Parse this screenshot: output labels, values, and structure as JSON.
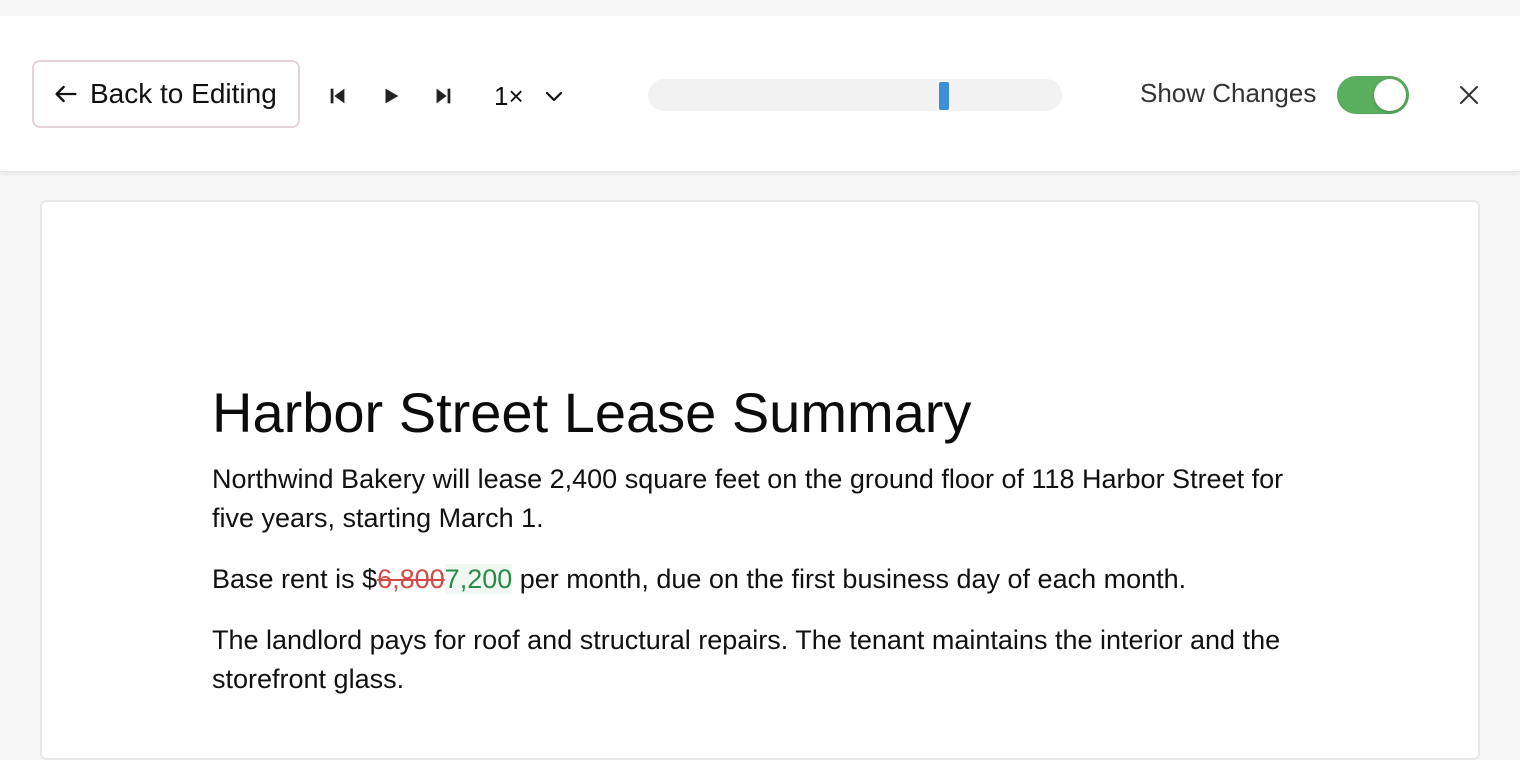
{
  "toolbar": {
    "back_label": "Back to Editing",
    "speed_label": "1×",
    "show_changes_label": "Show Changes",
    "show_changes_on": true,
    "timeline_position": 0.715,
    "colors": {
      "toggle_on": "#5aaf5f",
      "timeline_thumb": "#3f8fd6"
    },
    "icons": [
      "arrow-left-icon",
      "skip-back-icon",
      "play-icon",
      "skip-forward-icon",
      "chevron-down-icon",
      "close-icon"
    ]
  },
  "document": {
    "title": "Harbor Street Lease Summary",
    "paragraph1": "Northwind Bakery will lease 2,400 square feet on the ground floor of 118 Harbor Street for five years, starting March 1.",
    "paragraph2": {
      "before": "Base rent is $",
      "deleted": "6,800",
      "inserted": "7,200",
      "after": " per month, due on the first business day of each month."
    },
    "paragraph3": "The landlord pays for roof and structural repairs. The tenant maintains the interior and the storefront glass.",
    "colors": {
      "deleted": "#d24a46",
      "inserted": "#2c8a4b"
    }
  }
}
